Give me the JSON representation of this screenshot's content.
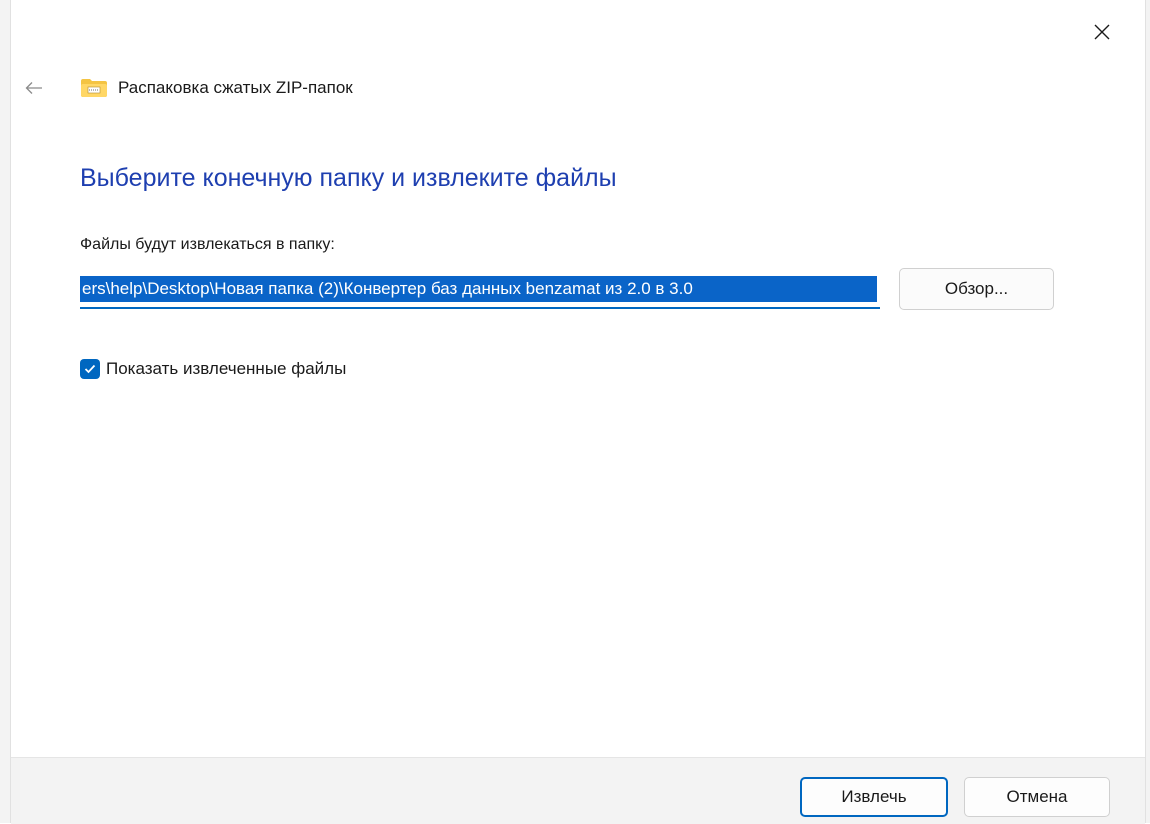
{
  "window": {
    "title": "Распаковка сжатых ZIP-папок",
    "icons": {
      "close": "close-icon",
      "back": "back-arrow-icon",
      "app": "zip-folder-icon"
    }
  },
  "main": {
    "heading": "Выберите конечную папку и извлеките файлы",
    "path_label": "Файлы будут извлекаться в папку:",
    "path_value": "ers\\help\\Desktop\\Новая папка (2)\\Конвертер баз данных benzamat из 2.0 в 3.0",
    "browse_label": "Обзор...",
    "show_files_label": "Показать извлеченные файлы",
    "show_files_checked": true
  },
  "footer": {
    "extract_label": "Извлечь",
    "cancel_label": "Отмена"
  },
  "colors": {
    "accent": "#0067c0",
    "heading": "#1e3fb0",
    "selection": "#0a64c8",
    "footer_bg": "#f3f3f3"
  }
}
